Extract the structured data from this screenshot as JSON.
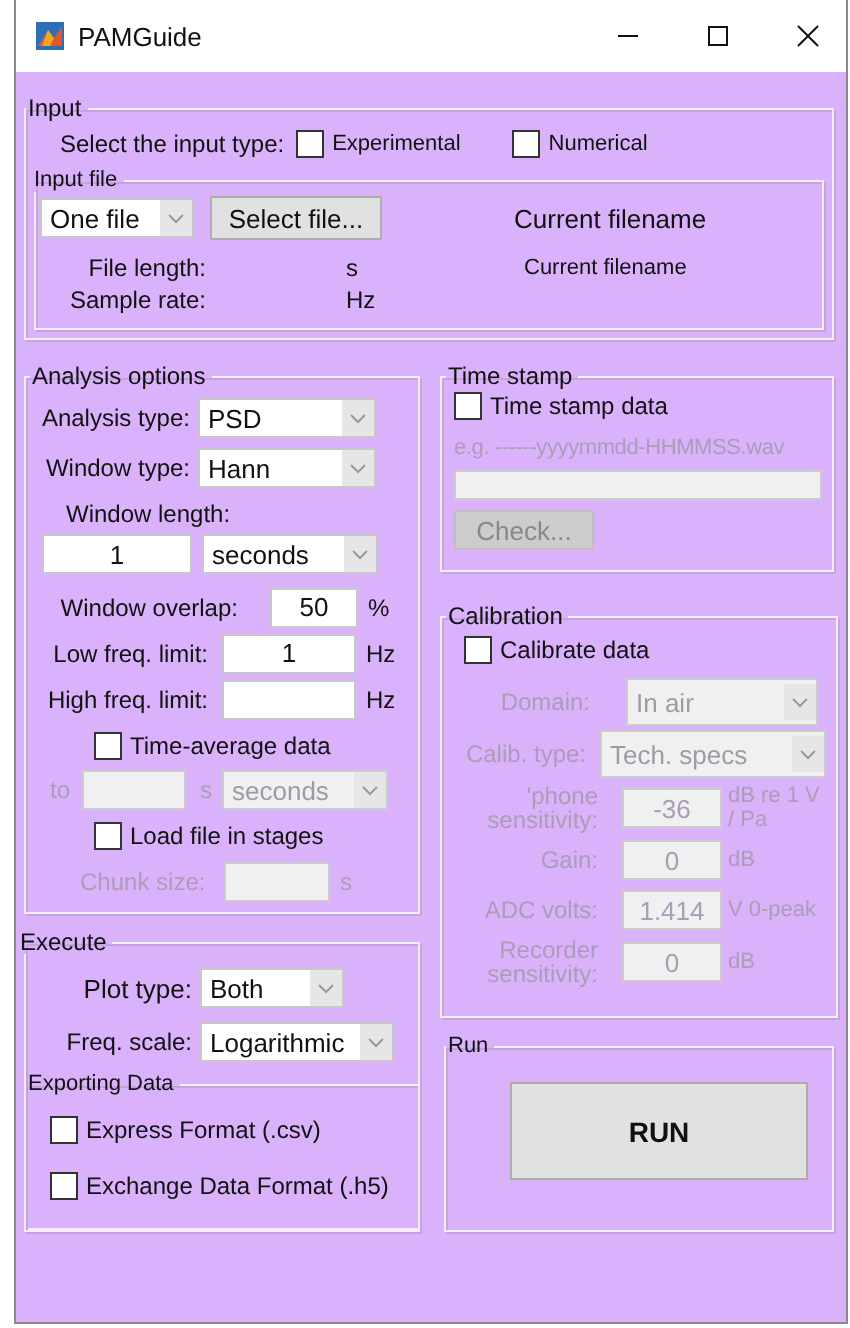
{
  "window": {
    "title": "PAMGuide"
  },
  "input": {
    "title": "Input",
    "type_label": "Select the input type:",
    "types": [
      {
        "label": "Experimental",
        "checked": false
      },
      {
        "label": "Numerical",
        "checked": false
      }
    ],
    "input_file": {
      "title": "Input file",
      "mode": "One file",
      "select_button": "Select file...",
      "current_filename": "Current filename",
      "file_length_label": "File length:",
      "file_length_unit": "s",
      "filename_small": "Current filename",
      "sample_rate_label": "Sample rate:",
      "sample_rate_unit": "Hz"
    }
  },
  "analysis": {
    "title": "Analysis options",
    "analysis_type": {
      "label": "Analysis type:",
      "value": "PSD"
    },
    "window_type": {
      "label": "Window type:",
      "value": "Hann"
    },
    "window_length": {
      "label": "Window length:",
      "value": "1",
      "unit": "seconds"
    },
    "window_overlap": {
      "label": "Window overlap:",
      "value": "50",
      "unit": "%"
    },
    "low_freq": {
      "label": "Low freq. limit:",
      "value": "1",
      "unit": "Hz"
    },
    "high_freq": {
      "label": "High freq. limit:",
      "unit": "Hz"
    },
    "time_average": {
      "label": "Time-average data",
      "checked": false
    },
    "average_to": {
      "label": "to",
      "unit": "s",
      "unit_select": "seconds",
      "disabled": true
    },
    "load_stages": {
      "label": "Load file in stages",
      "checked": false
    },
    "chunk_size": {
      "label": "Chunk size:",
      "unit": "s",
      "disabled": true
    }
  },
  "time_stamp": {
    "title": "Time stamp",
    "checkbox": {
      "label": "Time stamp data",
      "checked": false
    },
    "hint": "e.g. ------yyyymmdd-HHMMSS.wav",
    "check_button": "Check...",
    "disabled": true
  },
  "calibration": {
    "title": "Calibration",
    "checkbox": {
      "label": "Calibrate data",
      "checked": false
    },
    "disabled": true,
    "domain": {
      "label": "Domain:",
      "value": "In air"
    },
    "calib_type": {
      "label": "Calib. type:",
      "value": "Tech. specs"
    },
    "fields": [
      {
        "label": "'phone sensitivity:",
        "value": "-36",
        "unit": "dB re 1 V / Pa"
      },
      {
        "label": "Gain:",
        "value": "0",
        "unit": "dB"
      },
      {
        "label": "ADC volts:",
        "value": "1.414",
        "unit": "V 0-peak"
      },
      {
        "label": "Recorder sensitivity:",
        "value": "0",
        "unit": "dB"
      }
    ]
  },
  "execute": {
    "title": "Execute",
    "plot_type": {
      "label": "Plot type:",
      "value": "Both"
    },
    "freq_scale": {
      "label": "Freq. scale:",
      "value": "Logarithmic"
    },
    "exporting": {
      "title": "Exporting Data",
      "options": [
        {
          "label": "Express Format (.csv)",
          "checked": false
        },
        {
          "label": "Exchange Data Format (.h5)",
          "checked": false
        }
      ]
    }
  },
  "run": {
    "title": "Run",
    "button": "RUN"
  }
}
